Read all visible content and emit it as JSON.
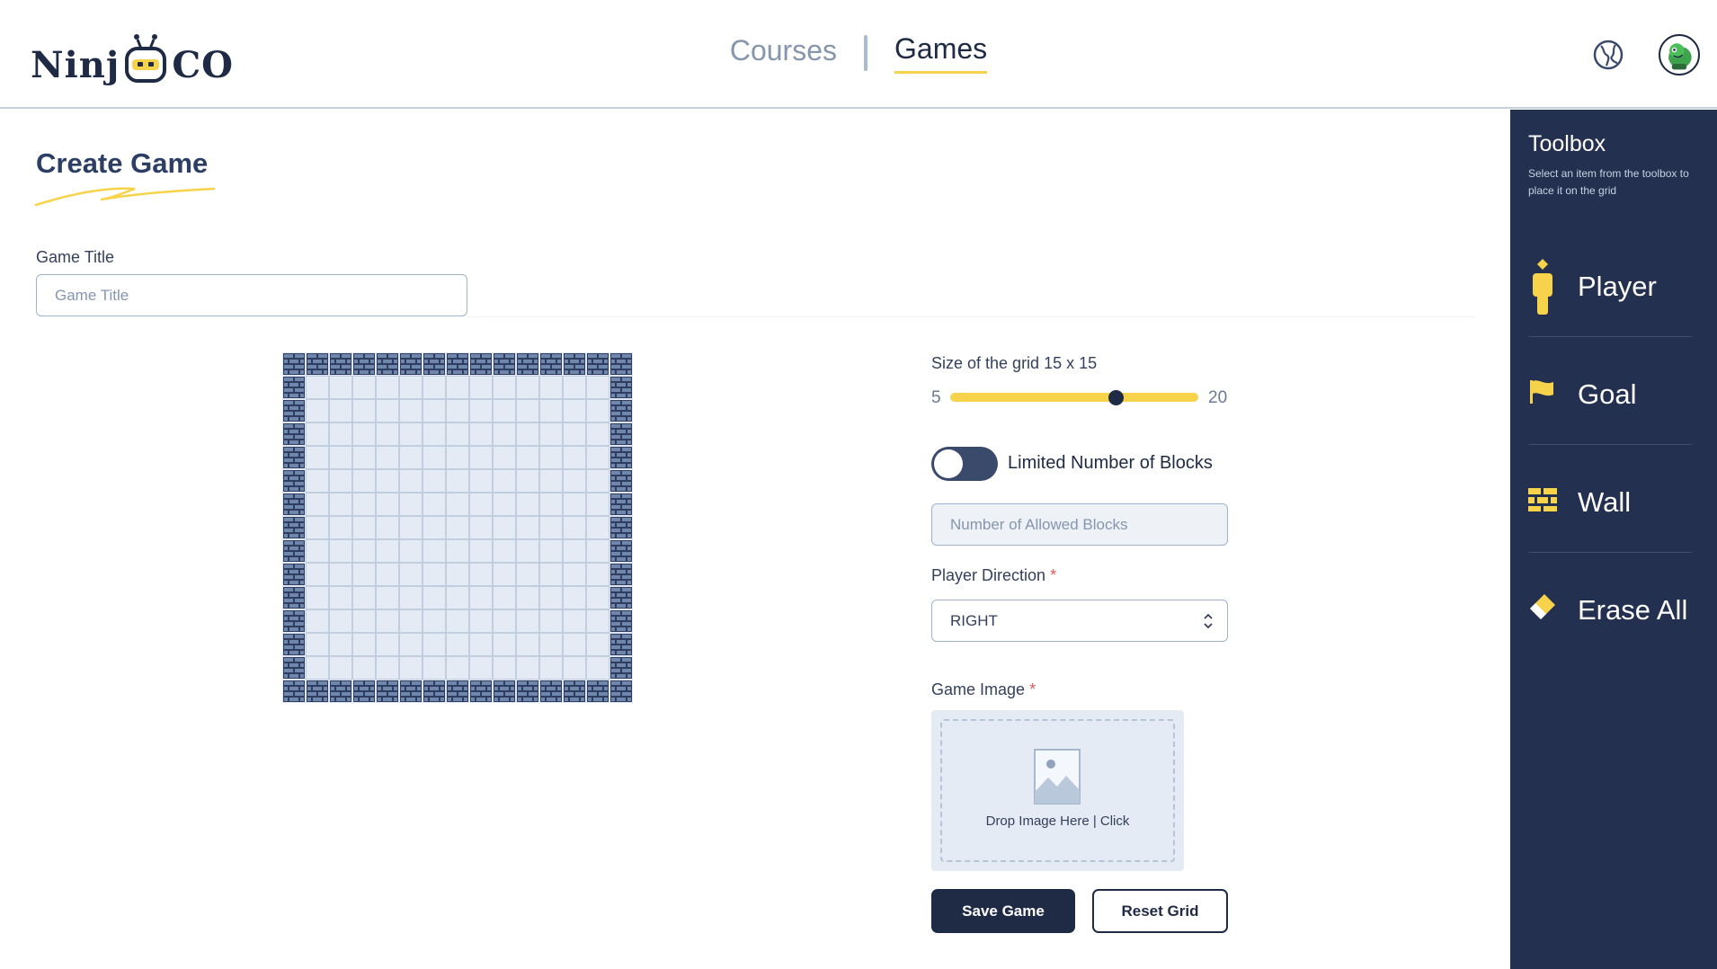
{
  "header": {
    "logo_left": "Ninj",
    "logo_right": "CO",
    "nav": {
      "courses": "Courses",
      "games": "Games"
    }
  },
  "page": {
    "title": "Create Game"
  },
  "form": {
    "game_title_label": "Game Title",
    "game_title_placeholder": "Game Title",
    "grid_size_label": "Size of the grid 15 x 15",
    "slider": {
      "min": "5",
      "max": "20",
      "value": 15
    },
    "limited_blocks_label": "Limited Number of Blocks",
    "limited_blocks_enabled": false,
    "allowed_blocks_placeholder": "Number of Allowed Blocks",
    "player_direction_label": "Player Direction",
    "player_direction_value": "RIGHT",
    "required_mark": "*",
    "game_image_label": "Game Image",
    "dropzone_text": "Drop Image Here | Click",
    "save_button": "Save Game",
    "reset_button": "Reset Grid"
  },
  "grid": {
    "rows": 15,
    "cols": 15,
    "border": "wall",
    "interior": "empty"
  },
  "toolbox": {
    "title": "Toolbox",
    "subtitle": "Select an item from the toolbox to place it on the grid",
    "items": [
      {
        "label": "Player",
        "icon": "player-icon"
      },
      {
        "label": "Goal",
        "icon": "flag-icon"
      },
      {
        "label": "Wall",
        "icon": "wall-icon"
      },
      {
        "label": "Erase All",
        "icon": "eraser-icon"
      }
    ]
  },
  "colors": {
    "navy": "#1f2a44",
    "accent_yellow": "#f6d34a",
    "toolbox_bg": "#24304f",
    "cell_bg": "#e4ebf4"
  }
}
